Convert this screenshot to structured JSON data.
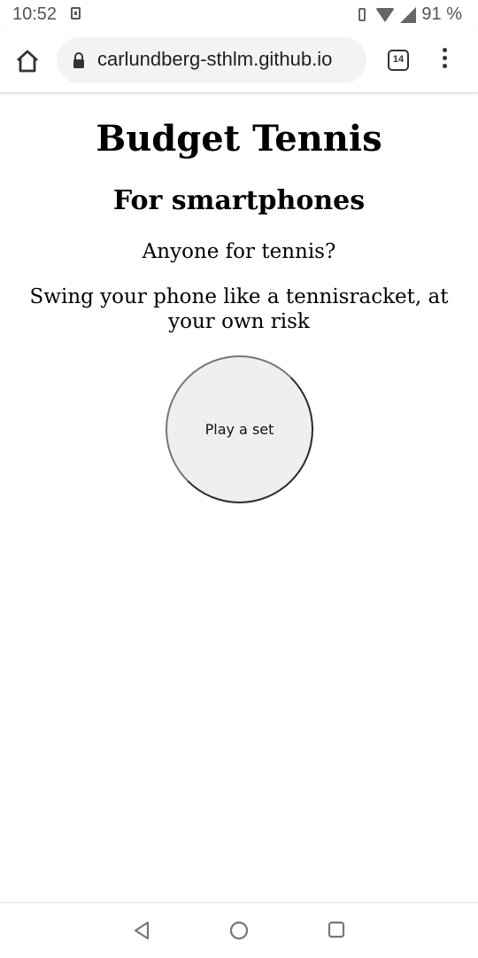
{
  "status_bar": {
    "time": "10:52",
    "battery": "91 %"
  },
  "browser": {
    "url": "carlundberg-sthlm.github.io",
    "tab_count": "14"
  },
  "page": {
    "title": "Budget Tennis",
    "subtitle": "For smartphones",
    "tagline": "Anyone for tennis?",
    "instructions": "Swing your phone like a tennisracket, at your own risk",
    "play_button_label": "Play a set"
  }
}
